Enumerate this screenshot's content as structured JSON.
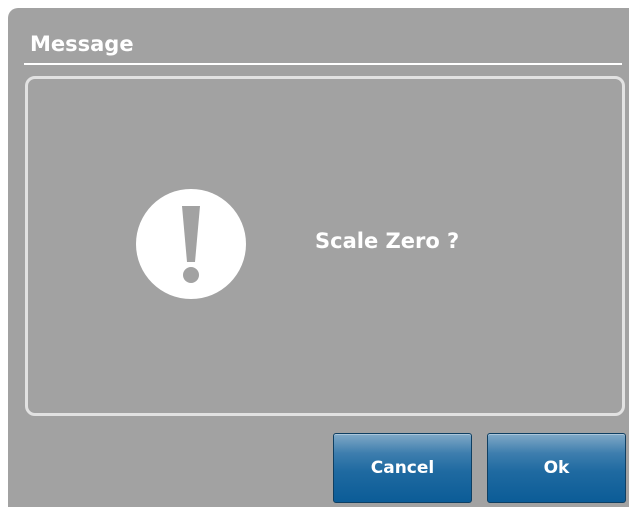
{
  "dialog": {
    "title": "Message",
    "message": "Scale Zero ?",
    "icon": "exclamation-icon"
  },
  "buttons": {
    "cancel_label": "Cancel",
    "ok_label": "Ok"
  },
  "colors": {
    "dialog_background": "#a2a2a2",
    "panel_border": "#e2e2e2",
    "text": "#ffffff",
    "button_top": "#81a9c7",
    "button_bottom": "#0b5c97"
  }
}
